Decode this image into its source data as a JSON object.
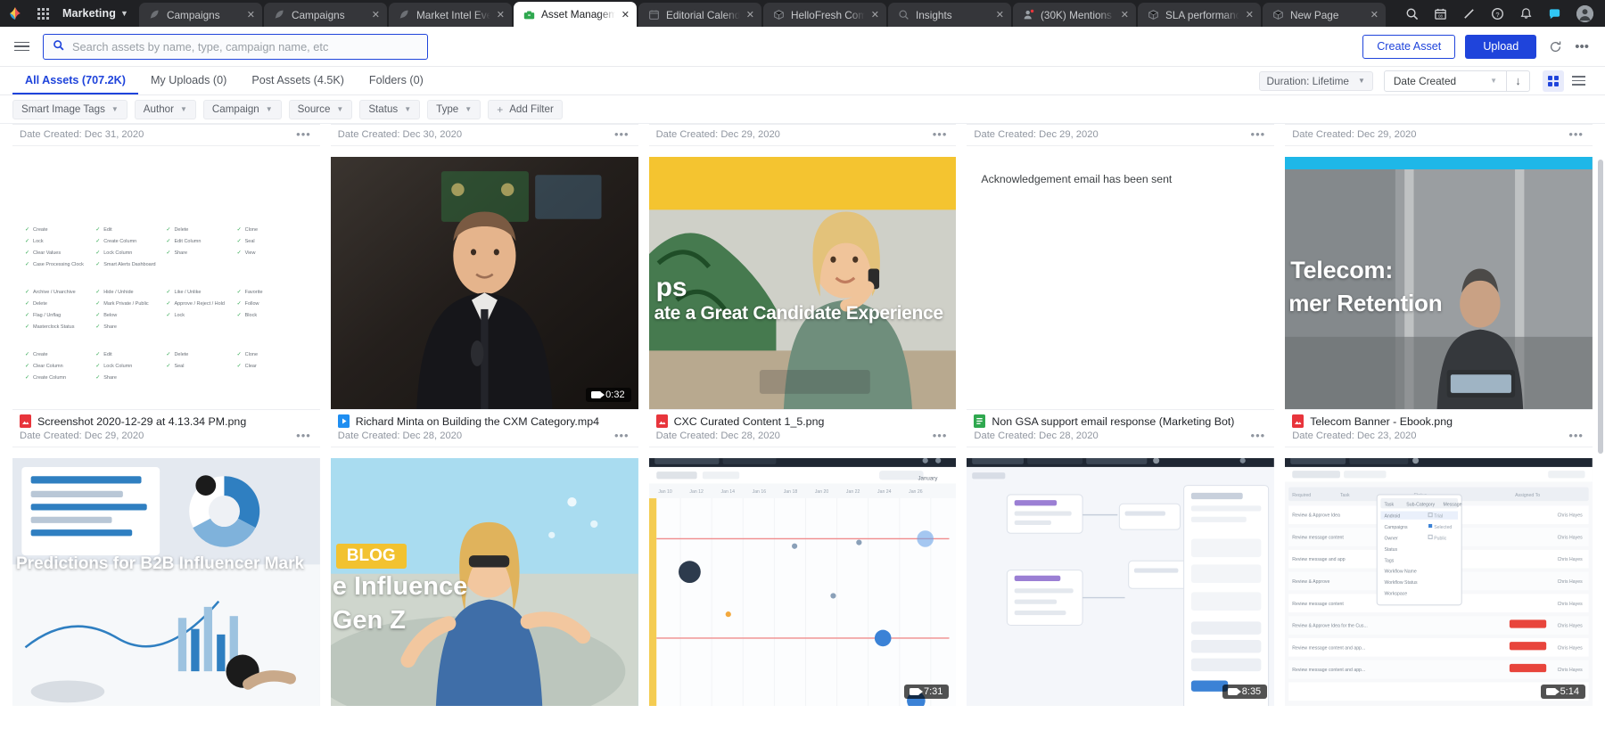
{
  "browser": {
    "workspace": "Marketing",
    "tabs": [
      {
        "label": "Campaigns",
        "icon": "feather-icon",
        "active": false
      },
      {
        "label": "Campaigns",
        "icon": "feather-icon",
        "active": false
      },
      {
        "label": "Market Intel Ever",
        "icon": "feather-icon",
        "active": false
      },
      {
        "label": "Asset Manageme",
        "icon": "briefcase-icon",
        "active": true
      },
      {
        "label": "Editorial Calenda",
        "icon": "calendar-icon",
        "active": false
      },
      {
        "label": "HelloFresh Comp",
        "icon": "cube-icon",
        "active": false
      },
      {
        "label": "Insights",
        "icon": "insights-icon",
        "active": false
      },
      {
        "label": "(30K) Mentions",
        "icon": "mentions-icon",
        "active": false
      },
      {
        "label": "SLA performanc",
        "icon": "cube-icon",
        "active": false
      },
      {
        "label": "New Page",
        "icon": "cube-icon",
        "active": false
      }
    ],
    "new_tab_label": "+",
    "sys_icons": [
      "search-icon",
      "calendar-icon",
      "pencil-icon",
      "help-icon",
      "bell-icon",
      "chat-icon",
      "profile-avatar"
    ]
  },
  "header": {
    "menu_icon": "hamburger-icon",
    "search": {
      "placeholder": "Search assets by name, type, campaign name, etc",
      "value": "",
      "icon": "search-icon"
    },
    "create_asset_label": "Create Asset",
    "upload_label": "Upload",
    "refresh_icon": "refresh-icon",
    "more_icon": "more-horizontal-icon"
  },
  "subtabs": {
    "items": [
      {
        "label": "All Assets (707.2K)",
        "active": true
      },
      {
        "label": "My Uploads (0)",
        "active": false
      },
      {
        "label": "Post Assets (4.5K)",
        "active": false
      },
      {
        "label": "Folders (0)",
        "active": false
      }
    ],
    "duration_label": "Duration: Lifetime",
    "sort_value": "Date Created",
    "sort_direction_icon": "arrow-down-icon",
    "grid_view_icon": "grid-view-icon",
    "list_view_icon": "list-view-icon"
  },
  "filters": {
    "chips": [
      "Smart Image Tags",
      "Author",
      "Campaign",
      "Source",
      "Status",
      "Type"
    ],
    "add_filter_label": "Add Filter"
  },
  "colors": {
    "accent": "#1f44db",
    "tab_active_bg": "#ffffff",
    "chrome_bg": "#202124",
    "pdf_red": "#e8353c",
    "video_blue": "#1f8ef1",
    "doc_green": "#2fa84f"
  },
  "grid": {
    "row_top": [
      {
        "date": "Date Created: Dec 31, 2020"
      },
      {
        "date": "Date Created: Dec 30, 2020"
      },
      {
        "date": "Date Created: Dec 29, 2020"
      },
      {
        "date": "Date Created: Dec 29, 2020"
      },
      {
        "date": "Date Created: Dec 29, 2020"
      }
    ],
    "row_main": [
      {
        "title": "Screenshot 2020-12-29 at 4.13.34 PM.png",
        "date": "Date Created: Dec 29, 2020",
        "filetype": "pdf",
        "thumb": "screenshot-table",
        "overlay_text": "",
        "duration": ""
      },
      {
        "title": "Richard Minta on Building the CXM Category.mp4",
        "date": "Date Created: Dec 28, 2020",
        "filetype": "mp4",
        "thumb": "person-speaker",
        "overlay_text": "",
        "duration": "0:32"
      },
      {
        "title": "CXC Curated Content 1_5.png",
        "date": "Date Created: Dec 28, 2020",
        "filetype": "pdf",
        "thumb": "woman-phone",
        "overlay_text": "ate a Great Candidate Experience",
        "overlay_text2": "ps",
        "duration": ""
      },
      {
        "title": "Non GSA support email response (Marketing Bot)",
        "date": "Date Created: Dec 28, 2020",
        "filetype": "doc",
        "thumb": "text-note",
        "note_text": "Acknowledgement email has been sent",
        "duration": ""
      },
      {
        "title": "Telecom Banner - Ebook.png",
        "date": "Date Created: Dec 23, 2020",
        "filetype": "pdf",
        "thumb": "telecom-banner",
        "overlay_text": "Telecom:",
        "overlay_text2": "mer Retention",
        "duration": ""
      }
    ],
    "row_bottom": [
      {
        "thumb": "chart-report",
        "overlay_text": "Predictions for B2B Influencer Mark",
        "duration": ""
      },
      {
        "thumb": "beach-blog",
        "overlay_text": "BLOG",
        "overlay_text2": "e Influence",
        "overlay_text3": "Gen Z",
        "duration": ""
      },
      {
        "thumb": "app-calendar",
        "duration": "7:31"
      },
      {
        "thumb": "app-workflow",
        "duration": "8:35"
      },
      {
        "thumb": "app-tasks",
        "duration": "5:14"
      }
    ]
  }
}
